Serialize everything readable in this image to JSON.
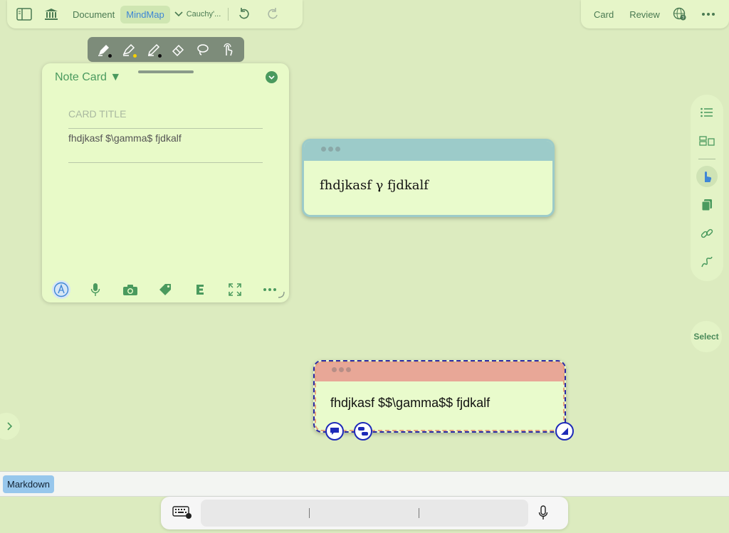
{
  "toolbar": {
    "document_label": "Document",
    "mindmap_label": "MindMap",
    "file_label": "Cauchy'...",
    "card_label": "Card",
    "review_label": "Review"
  },
  "drawing_tools": [
    "pen",
    "highlighter",
    "pencil",
    "eraser",
    "lasso",
    "touch"
  ],
  "tool_colors": {
    "pen": "#111111",
    "highlighter": "#f5d000",
    "pencil": "#111111"
  },
  "note_panel": {
    "title": "Note Card ▼",
    "card_title_placeholder": "CARD TITLE",
    "card_body": "fhdjkasf $\\gamma$ fjdkalf"
  },
  "cards": [
    {
      "text": "fhdjkasf γ fjdkalf",
      "header_color": "#9ccbc9"
    },
    {
      "text": "fhdjkasf $$\\gamma$$ fjdkalf",
      "header_color": "#e8a797"
    }
  ],
  "sidebar": {
    "select_label": "Select"
  },
  "format_bar": {
    "markdown_label": "Markdown"
  },
  "colors": {
    "background": "#dcebbf",
    "accent": "#4a9a5e",
    "active_tab": "#3e86d6"
  }
}
